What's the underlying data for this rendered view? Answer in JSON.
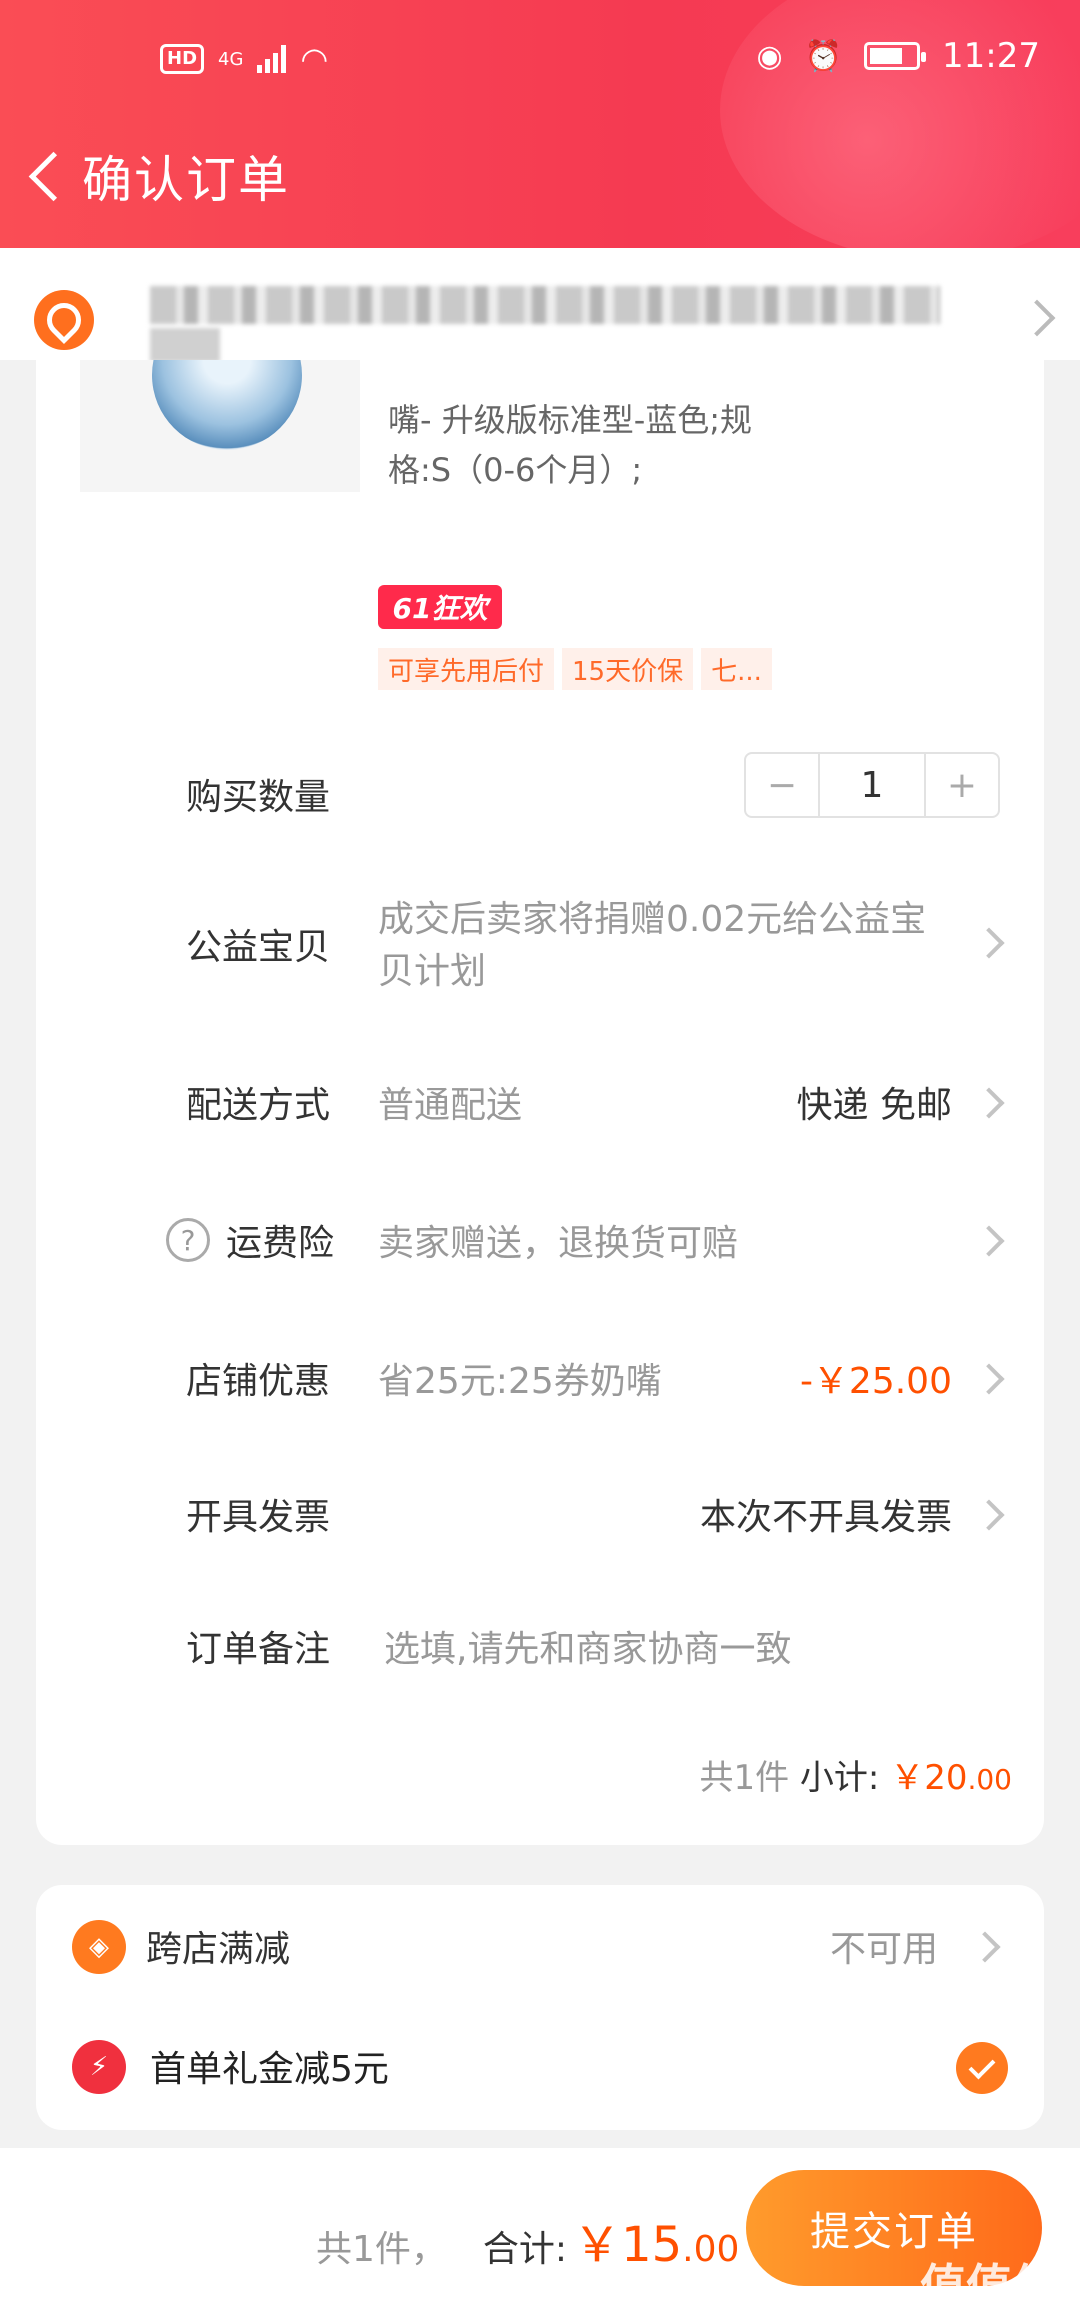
{
  "status_bar": {
    "left_badge": "HD",
    "network": "4G",
    "time": "11:27"
  },
  "header": {
    "title": "确认订单"
  },
  "product": {
    "sku_text": "嘴- 升级版标准型-蓝色;规格:S（0-6个月）;",
    "promo_tag": "61狂欢",
    "chips": [
      "可享先用后付",
      "15天价保",
      "七..."
    ]
  },
  "quantity": {
    "label": "购买数量",
    "value": "1",
    "minus": "−",
    "plus": "+"
  },
  "charity": {
    "label": "公益宝贝",
    "desc": "成交后卖家将捐赠0.02元给公益宝贝计划"
  },
  "delivery": {
    "label": "配送方式",
    "desc": "普通配送",
    "value": "快递 免邮"
  },
  "insurance": {
    "icon": "?",
    "label": "运费险",
    "desc": "卖家赠送，退换货可赔"
  },
  "shop_discount": {
    "label": "店铺优惠",
    "desc": "省25元:25券奶嘴",
    "value": "-￥25.00"
  },
  "invoice": {
    "label": "开具发票",
    "value": "本次不开具发票"
  },
  "remark": {
    "label": "订单备注",
    "placeholder": "选填,请先和商家协商一致"
  },
  "subtotal": {
    "count": "共1件",
    "label": "小计:",
    "currency": "￥",
    "int": "20",
    "dec": ".00"
  },
  "cross_store": {
    "label": "跨店满减",
    "value": "不可用"
  },
  "first_order": {
    "label": "首单礼金减5元"
  },
  "footer": {
    "count": "共1件，",
    "label": "合计:",
    "currency": "￥",
    "int": "15",
    "dec": ".00",
    "submit": "提交订单",
    "watermark": "值值值"
  },
  "colors": {
    "header": "#f53a52",
    "accent": "#ff5000",
    "submit": "#ff7a1f"
  }
}
